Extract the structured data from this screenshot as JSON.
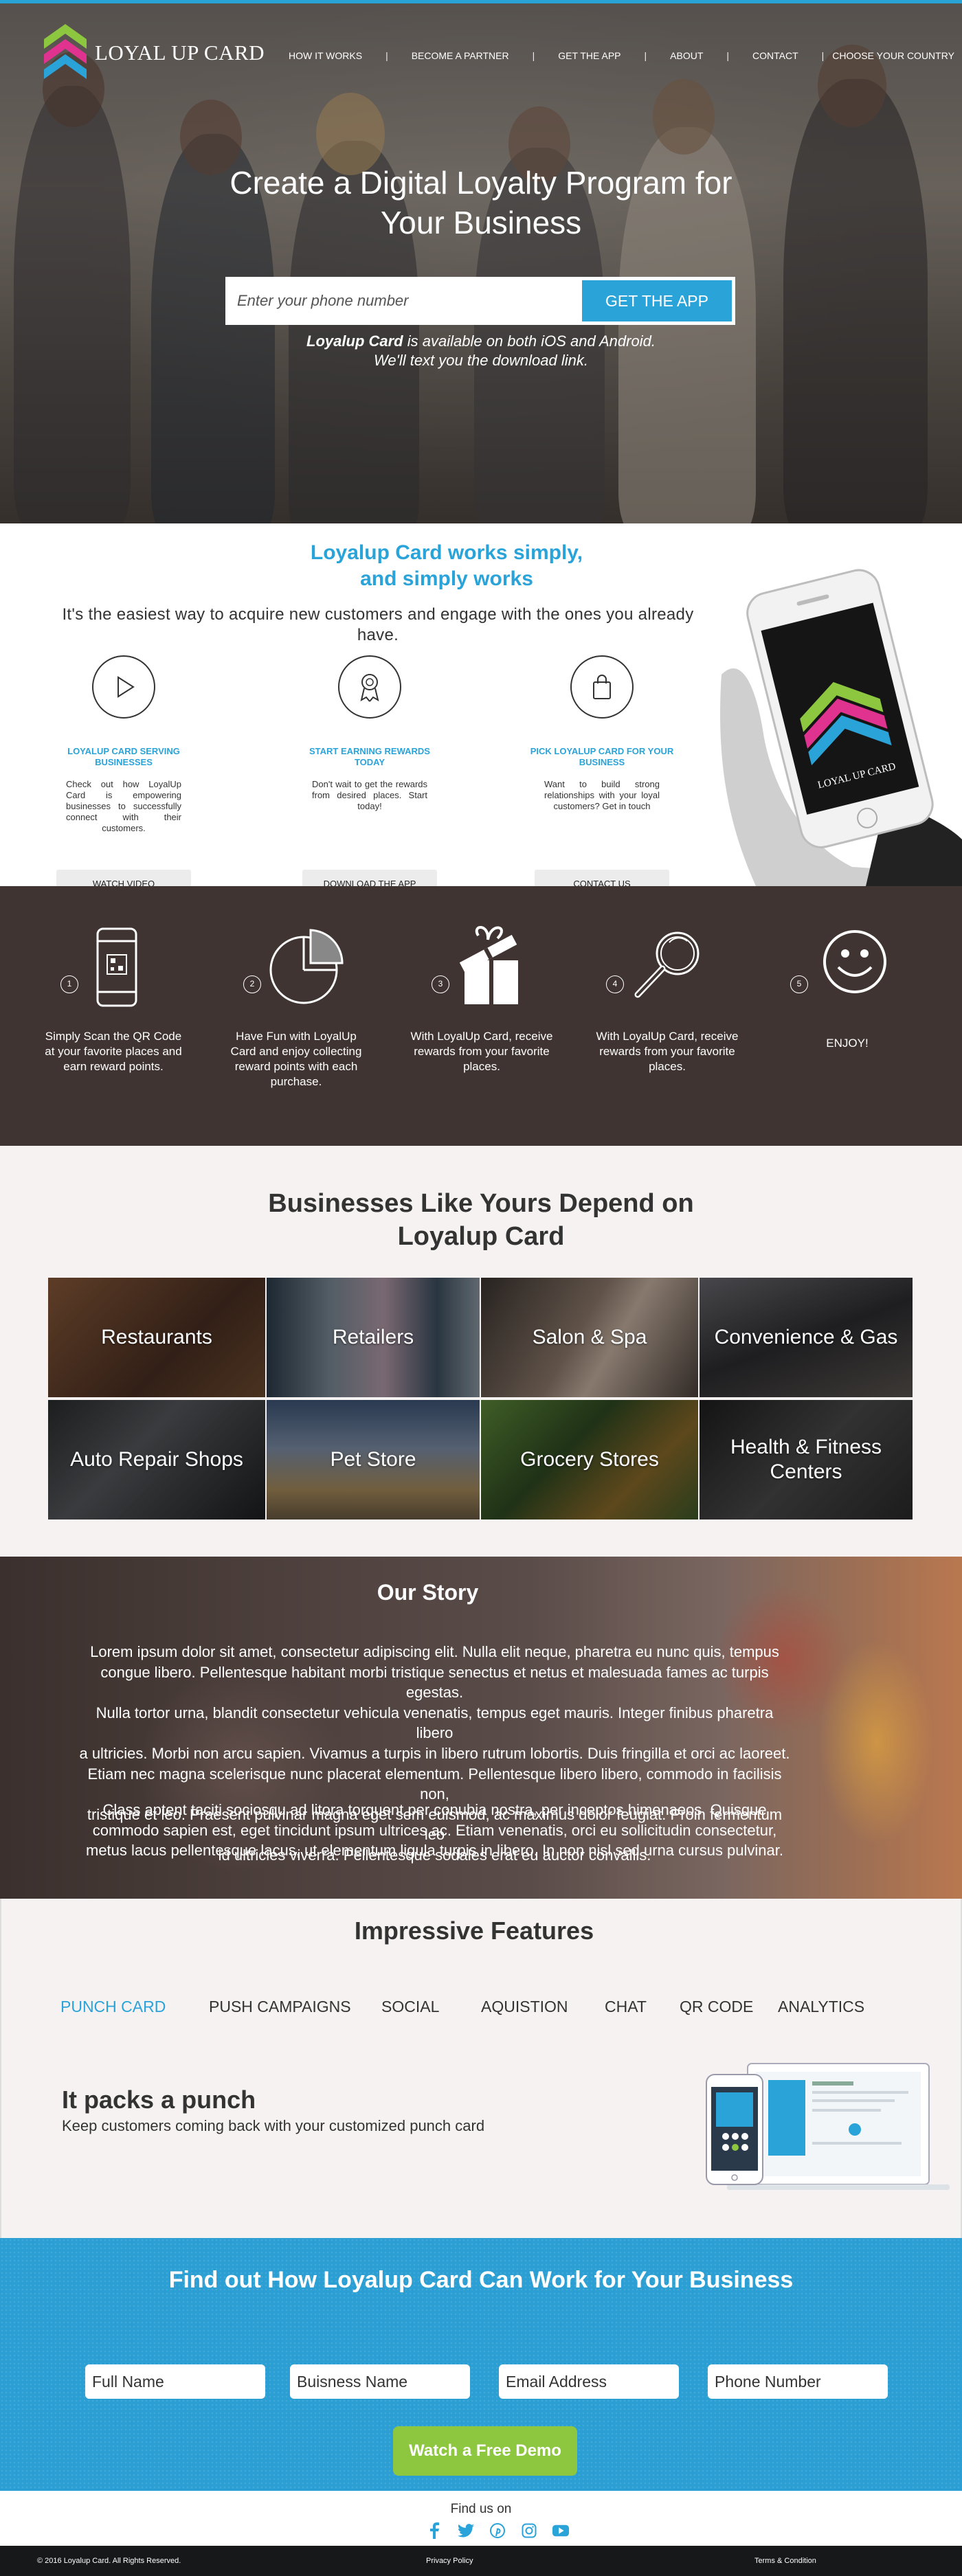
{
  "brand": {
    "name": "LOYAL UP CARD",
    "colors": {
      "accent": "#2aa3d9",
      "dark": "#3f3431",
      "cta": "#8dc63f",
      "page_bg": "#f6f2f2"
    }
  },
  "nav": {
    "items": [
      "HOW IT WORKS",
      "BECOME A PARTNER",
      "GET THE APP",
      "ABOUT",
      "CONTACT",
      "CHOOSE YOUR COUNTRY"
    ]
  },
  "hero": {
    "title_line1": "Create a Digital Loyalty Program for",
    "title_line2": "Your Business",
    "phone_placeholder": "Enter your phone number",
    "get_app_label": "GET THE APP",
    "sub_brand": "Loyalup Card",
    "sub_line1_rest": " is available on both iOS and Android.",
    "sub_line2": "We'll text you the download link."
  },
  "works": {
    "title_line1": "Loyalup Card works simply,",
    "title_line2": "and simply works",
    "description": "It's the easiest way to acquire new customers and engage with the ones you already have.",
    "features": [
      {
        "icon": "play-icon",
        "title": "LOYALUP CARD SERVING BUSINESSES",
        "text": "Check out how LoyalUp Card is empowering businesses to successfully connect with their customers.",
        "button": "WATCH VIDEO"
      },
      {
        "icon": "award-icon",
        "title": "START EARNING REWARDS TODAY",
        "text": "Don't wait to get the rewards from desired places. Start today!",
        "button": "DOWNLOAD THE APP"
      },
      {
        "icon": "shopping-bag-icon",
        "title": "PICK LOYALUP CARD FOR YOUR BUSINESS",
        "text": "Want to build strong relationships with your loyal customers? Get in touch",
        "button": "CONTACT US"
      }
    ],
    "phone_screen_text": "LOYAL UP CARD"
  },
  "steps": [
    {
      "number": "1",
      "icon": "qr-phone-icon",
      "text": "Simply Scan the QR Code at your favorite places and earn reward points."
    },
    {
      "number": "2",
      "icon": "pie-chart-icon",
      "text": "Have Fun with LoyalUp Card and enjoy collecting reward points with each purchase."
    },
    {
      "number": "3",
      "icon": "gift-icon",
      "text": "With LoyalUp Card, receive rewards from your favorite places."
    },
    {
      "number": "4",
      "icon": "magnifier-icon",
      "text": "With LoyalUp Card, receive rewards from your favorite places."
    },
    {
      "number": "5",
      "icon": "smiley-icon",
      "text": "ENJOY!"
    }
  ],
  "businesses": {
    "title_line1": "Businesses Like Yours Depend on",
    "title_line2": "Loyalup Card",
    "tiles": [
      {
        "label": "Restaurants",
        "color": "#6b4a32"
      },
      {
        "label": "Retailers",
        "color": "#4c5b68"
      },
      {
        "label": "Salon & Spa",
        "color": "#5d5550"
      },
      {
        "label": "Convenience & Gas",
        "color": "#4a4a4e"
      },
      {
        "label": "Auto Repair Shops",
        "color": "#3b3d3f"
      },
      {
        "label": "Pet Store",
        "color": "#5f6e83"
      },
      {
        "label": "Grocery Stores",
        "color": "#4f6a3a"
      },
      {
        "label": "Health & Fitness Centers",
        "color": "#343434"
      }
    ]
  },
  "story": {
    "title": "Our Story",
    "p1_lines": [
      "Lorem ipsum dolor sit amet, consectetur adipiscing elit. Nulla elit neque, pharetra eu nunc quis, tempus",
      "congue libero. Pellentesque habitant morbi tristique senectus et netus et malesuada fames ac turpis egestas.",
      "Nulla tortor urna, blandit consectetur vehicula venenatis, tempus eget mauris. Integer finibus pharetra libero",
      "a ultricies. Morbi non arcu sapien. Vivamus a turpis in libero rutrum lobortis. Duis fringilla et orci ac laoreet.",
      "Etiam nec magna scelerisque nunc placerat elementum. Pellentesque libero libero, commodo in facilisis non,",
      "tristique et leo. Praesent pulvinar magna eget sem euismod, ac maximus dolor feugiat. Proin fermentum leo",
      "id ultricies viverra. Pellentesque sodales erat eu auctor convallis."
    ],
    "p2_lines": [
      "Class aptent taciti sociosqu ad litora torquent per conubia nostra, per inceptos himenaeos. Quisque",
      "commodo sapien est, eget tincidunt ipsum ultrices ac. Etiam venenatis, orci eu sollicitudin consectetur,",
      "metus lacus pellentesque lacus, ut elementum ligula turpis in libero. In non nisl sed urna cursus pulvinar."
    ]
  },
  "features": {
    "title": "Impressive Features",
    "tabs": [
      "PUNCH CARD",
      "PUSH CAMPAIGNS",
      "SOCIAL",
      "AQUISTION",
      "CHAT",
      "QR CODE",
      "ANALYTICS"
    ],
    "active_tab": "PUNCH CARD",
    "pack_title": "It packs a punch",
    "pack_subtitle": "Keep customers coming back with your customized punch card"
  },
  "cta": {
    "title": "Find out How Loyalup Card Can Work for Your Business",
    "fields": [
      "Full Name",
      "Buisness Name",
      "Email Address",
      "Phone Number"
    ],
    "button": "Watch a Free Demo"
  },
  "footer": {
    "find_us": "Find us on",
    "social": [
      "facebook-icon",
      "twitter-icon",
      "pinterest-icon",
      "instagram-icon",
      "youtube-icon"
    ],
    "copyright": "© 2016 Loyalup Card. All Rights Reserved.",
    "privacy": "Privacy Policy",
    "terms": "Terms & Condition"
  }
}
